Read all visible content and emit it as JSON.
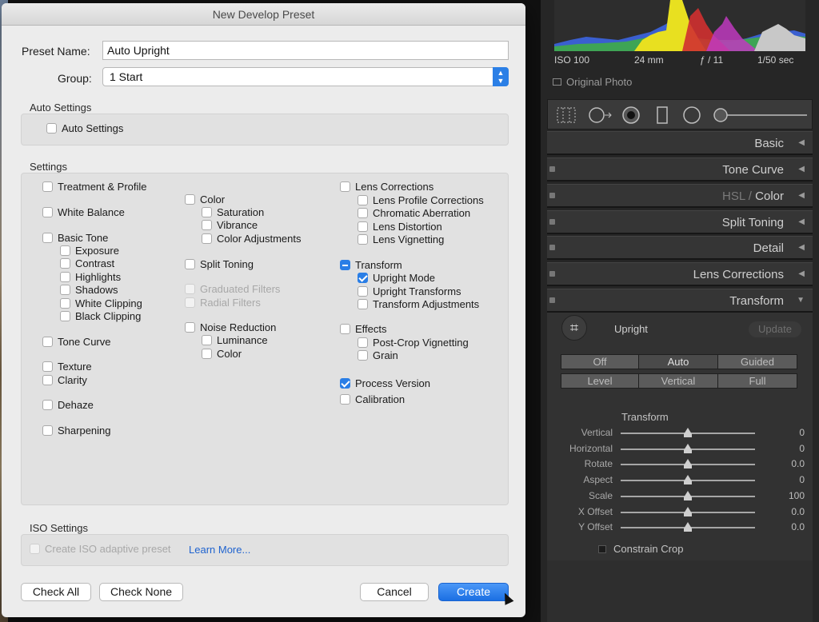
{
  "dialog": {
    "title": "New Develop Preset",
    "preset_name_label": "Preset Name:",
    "preset_name_value": "Auto Upright",
    "group_label": "Group:",
    "group_value": "1 Start",
    "auto_settings_title": "Auto Settings",
    "auto_settings_checkbox": "Auto Settings",
    "settings_title": "Settings",
    "col1": {
      "treatment_profile": "Treatment & Profile",
      "white_balance": "White Balance",
      "basic_tone": "Basic Tone",
      "exposure": "Exposure",
      "contrast": "Contrast",
      "highlights": "Highlights",
      "shadows": "Shadows",
      "white_clipping": "White Clipping",
      "black_clipping": "Black Clipping",
      "tone_curve": "Tone Curve",
      "texture": "Texture",
      "clarity": "Clarity",
      "dehaze": "Dehaze",
      "sharpening": "Sharpening"
    },
    "col2": {
      "color": "Color",
      "saturation": "Saturation",
      "vibrance": "Vibrance",
      "color_adjustments": "Color Adjustments",
      "split_toning": "Split Toning",
      "graduated_filters": "Graduated Filters",
      "radial_filters": "Radial Filters",
      "noise_reduction": "Noise Reduction",
      "luminance": "Luminance",
      "nr_color": "Color"
    },
    "col3": {
      "lens_corrections": "Lens Corrections",
      "lens_profile_corrections": "Lens Profile Corrections",
      "chromatic_aberration": "Chromatic Aberration",
      "lens_distortion": "Lens Distortion",
      "lens_vignetting": "Lens Vignetting",
      "transform": "Transform",
      "upright_mode": "Upright Mode",
      "upright_transforms": "Upright Transforms",
      "transform_adjustments": "Transform Adjustments",
      "effects": "Effects",
      "post_crop_vignetting": "Post-Crop Vignetting",
      "grain": "Grain",
      "process_version": "Process Version",
      "calibration": "Calibration"
    },
    "iso_title": "ISO Settings",
    "iso_checkbox": "Create ISO adaptive preset",
    "learn_more": "Learn More...",
    "buttons": {
      "check_all": "Check All",
      "check_none": "Check None",
      "cancel": "Cancel",
      "create": "Create"
    }
  },
  "lightroom": {
    "histogram_info": {
      "iso": "ISO 100",
      "focal": "24 mm",
      "aperture": "ƒ / 11",
      "shutter": "1/50 sec"
    },
    "original_photo": "Original Photo",
    "panels": {
      "basic": "Basic",
      "tone_curve": "Tone Curve",
      "hsl": "HSL",
      "hsl_sep": " / ",
      "color": "Color",
      "split_toning": "Split Toning",
      "detail": "Detail",
      "lens_corrections": "Lens Corrections",
      "transform": "Transform"
    },
    "upright": {
      "label": "Upright",
      "update": "Update",
      "modes_row1": [
        "Off",
        "Auto",
        "Guided"
      ],
      "modes_row2": [
        "Level",
        "Vertical",
        "Full"
      ],
      "active_mode": "Auto"
    },
    "transform_title": "Transform",
    "sliders": [
      {
        "label": "Vertical",
        "value": "0",
        "position": 0.5
      },
      {
        "label": "Horizontal",
        "value": "0",
        "position": 0.5
      },
      {
        "label": "Rotate",
        "value": "0.0",
        "position": 0.5
      },
      {
        "label": "Aspect",
        "value": "0",
        "position": 0.5
      },
      {
        "label": "Scale",
        "value": "100",
        "position": 0.5
      },
      {
        "label": "X Offset",
        "value": "0.0",
        "position": 0.5
      },
      {
        "label": "Y Offset",
        "value": "0.0",
        "position": 0.5
      }
    ],
    "constrain_crop": "Constrain Crop"
  },
  "colors": {
    "accent": "#2a7ee6",
    "panel_bg": "#262626"
  }
}
